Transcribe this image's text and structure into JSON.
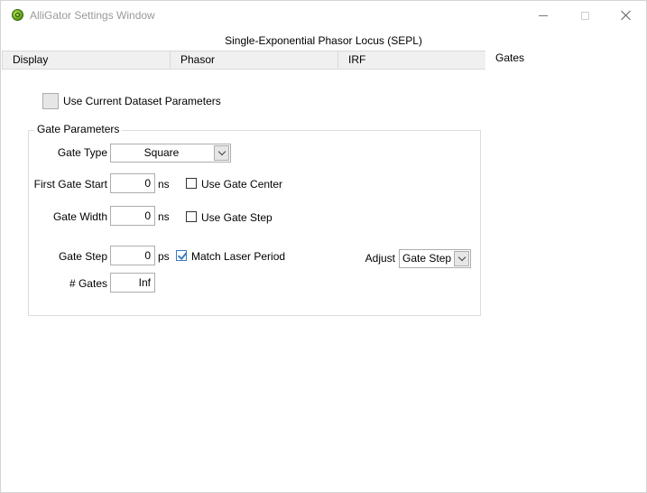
{
  "window": {
    "title": "AlliGator Settings Window"
  },
  "header": {
    "title": "Single-Exponential Phasor Locus (SEPL)"
  },
  "tabs": [
    {
      "label": "Display",
      "selected": false
    },
    {
      "label": "Phasor",
      "selected": false
    },
    {
      "label": "IRF",
      "selected": false
    },
    {
      "label": "Gates",
      "selected": true
    }
  ],
  "dataset": {
    "use_current_label": "Use Current Dataset Parameters",
    "use_current_checked": false
  },
  "gate_parameters": {
    "group_title": "Gate Parameters",
    "gate_type": {
      "label": "Gate Type",
      "value": "Square"
    },
    "first_gate_start": {
      "label": "First Gate Start",
      "value": "0",
      "unit": "ns"
    },
    "use_gate_center": {
      "label": "Use Gate Center",
      "checked": false
    },
    "gate_width": {
      "label": "Gate Width",
      "value": "0",
      "unit": "ns"
    },
    "use_gate_step": {
      "label": "Use Gate Step",
      "checked": false
    },
    "gate_step": {
      "label": "Gate Step",
      "value": "0",
      "unit": "ps"
    },
    "match_laser_period": {
      "label": "Match Laser Period",
      "checked": true
    },
    "num_gates": {
      "label": "# Gates",
      "value": "Inf"
    },
    "adjust": {
      "label": "Adjust",
      "value": "Gate Step"
    }
  },
  "colors": {
    "check_accent": "#3b7bbf",
    "tab_inactive_bg": "#f0f0f0",
    "title_text": "#9a9a9a"
  }
}
